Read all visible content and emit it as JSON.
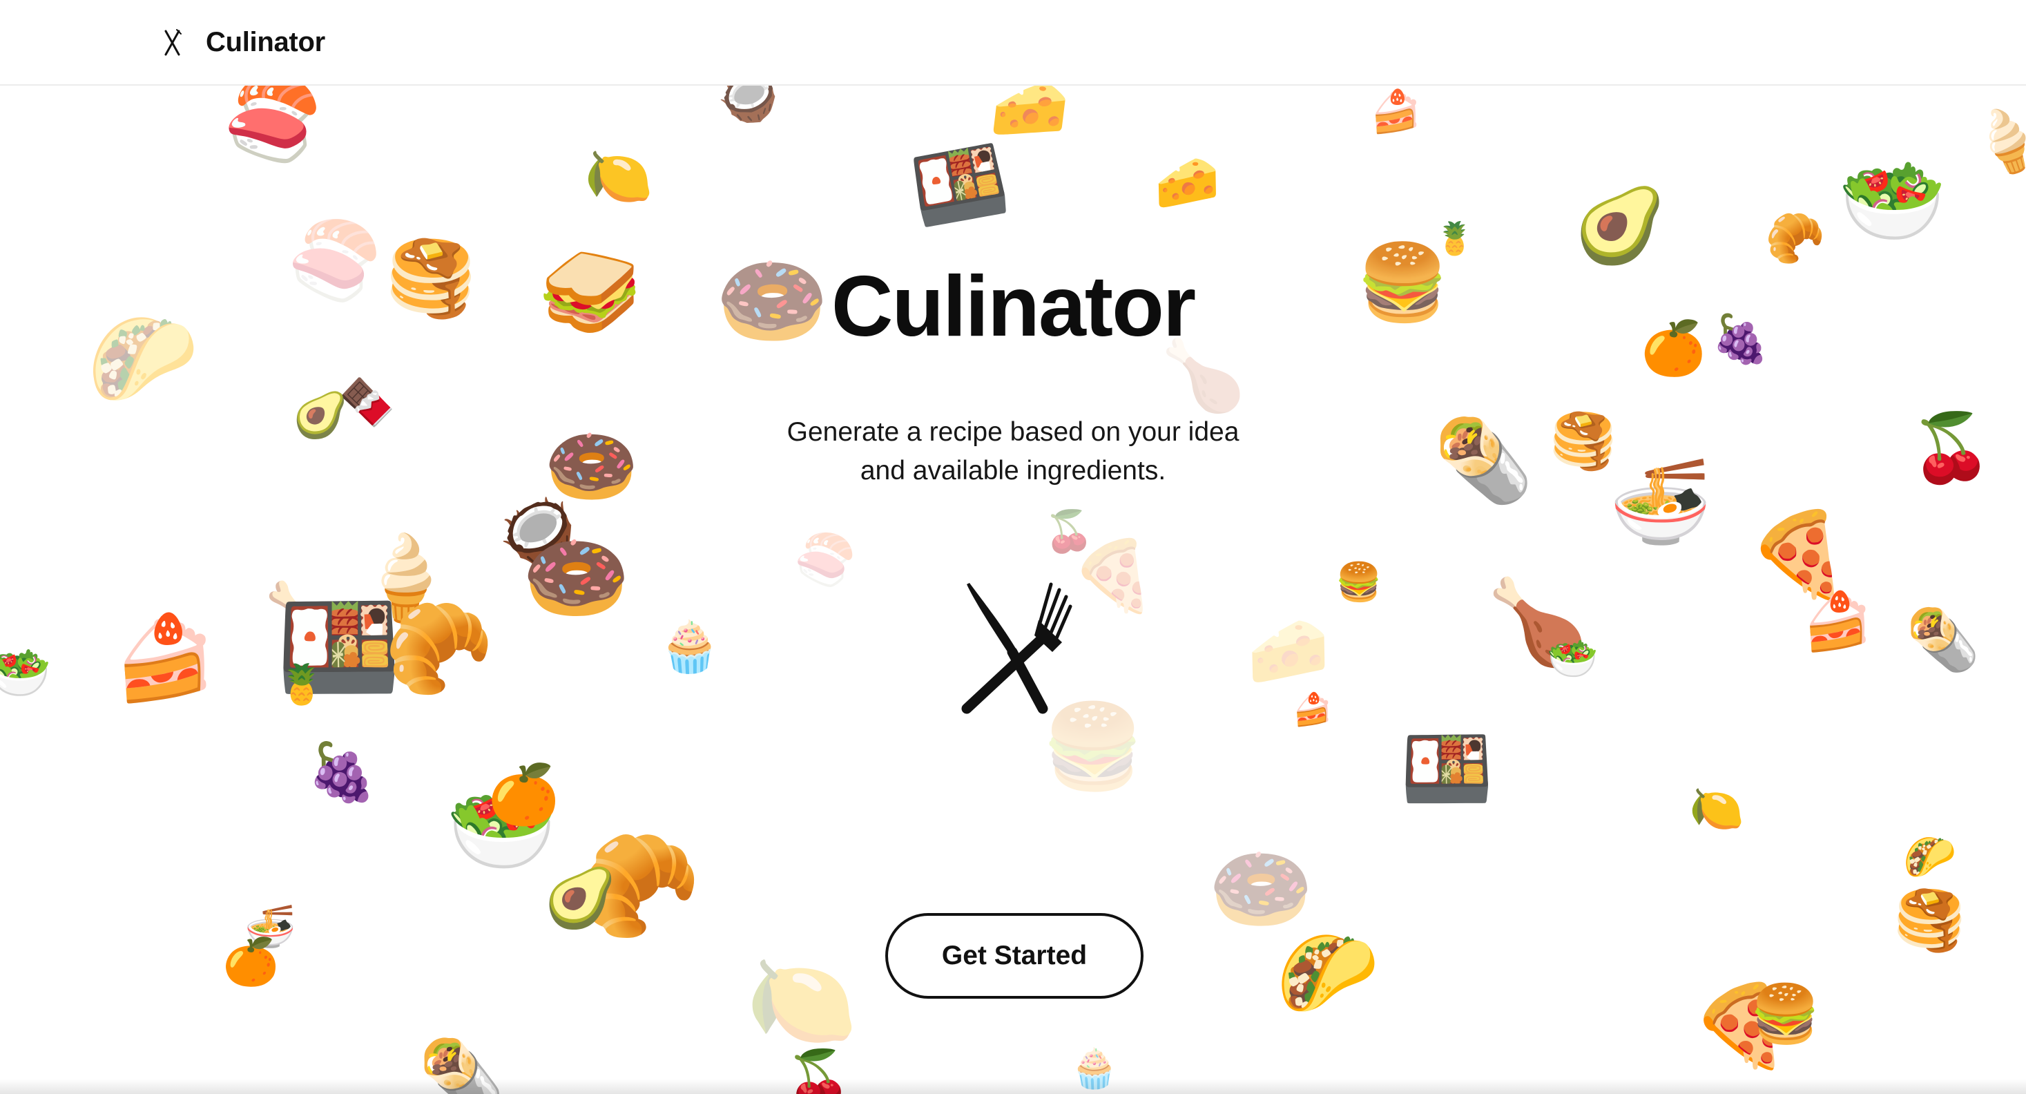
{
  "nav": {
    "brand_name": "Culinator",
    "brand_icon": "utensils-crossed-icon"
  },
  "hero": {
    "title": "Culinator",
    "subtitle_line1": "Generate a recipe based on your idea",
    "subtitle_line2": "and available ingredients.",
    "icon": "knife-fork-icon",
    "cta_label": "Get Started"
  },
  "background": {
    "decoration": "floating-food-emoji",
    "foods": [
      {
        "emoji": "🍣",
        "name": "sushi-icon"
      },
      {
        "emoji": "🥥",
        "name": "coconut-icon"
      },
      {
        "emoji": "🧀",
        "name": "cheese-icon"
      },
      {
        "emoji": "🍰",
        "name": "cake-slice-icon"
      },
      {
        "emoji": "🍦",
        "name": "soft-serve-icon"
      },
      {
        "emoji": "🍋",
        "name": "lemon-icon"
      },
      {
        "emoji": "🍱",
        "name": "bento-box-icon"
      },
      {
        "emoji": "🥑",
        "name": "avocado-icon"
      },
      {
        "emoji": "🍍",
        "name": "pineapple-icon"
      },
      {
        "emoji": "🥐",
        "name": "croissant-icon"
      },
      {
        "emoji": "🥗",
        "name": "salad-icon"
      },
      {
        "emoji": "🥞",
        "name": "pancakes-icon"
      },
      {
        "emoji": "🥪",
        "name": "sandwich-icon"
      },
      {
        "emoji": "🍩",
        "name": "doughnut-icon"
      },
      {
        "emoji": "🍔",
        "name": "hamburger-icon"
      },
      {
        "emoji": "🌮",
        "name": "taco-icon"
      },
      {
        "emoji": "🍫",
        "name": "chocolate-bar-icon"
      },
      {
        "emoji": "🍗",
        "name": "poultry-leg-icon"
      },
      {
        "emoji": "🍊",
        "name": "orange-icon"
      },
      {
        "emoji": "🍇",
        "name": "grapes-icon"
      },
      {
        "emoji": "🌯",
        "name": "burrito-icon"
      },
      {
        "emoji": "🍜",
        "name": "noodle-bowl-icon"
      },
      {
        "emoji": "🍒",
        "name": "cherries-icon"
      },
      {
        "emoji": "🍕",
        "name": "pizza-slice-icon"
      },
      {
        "emoji": "🧁",
        "name": "cupcake-icon"
      }
    ]
  }
}
